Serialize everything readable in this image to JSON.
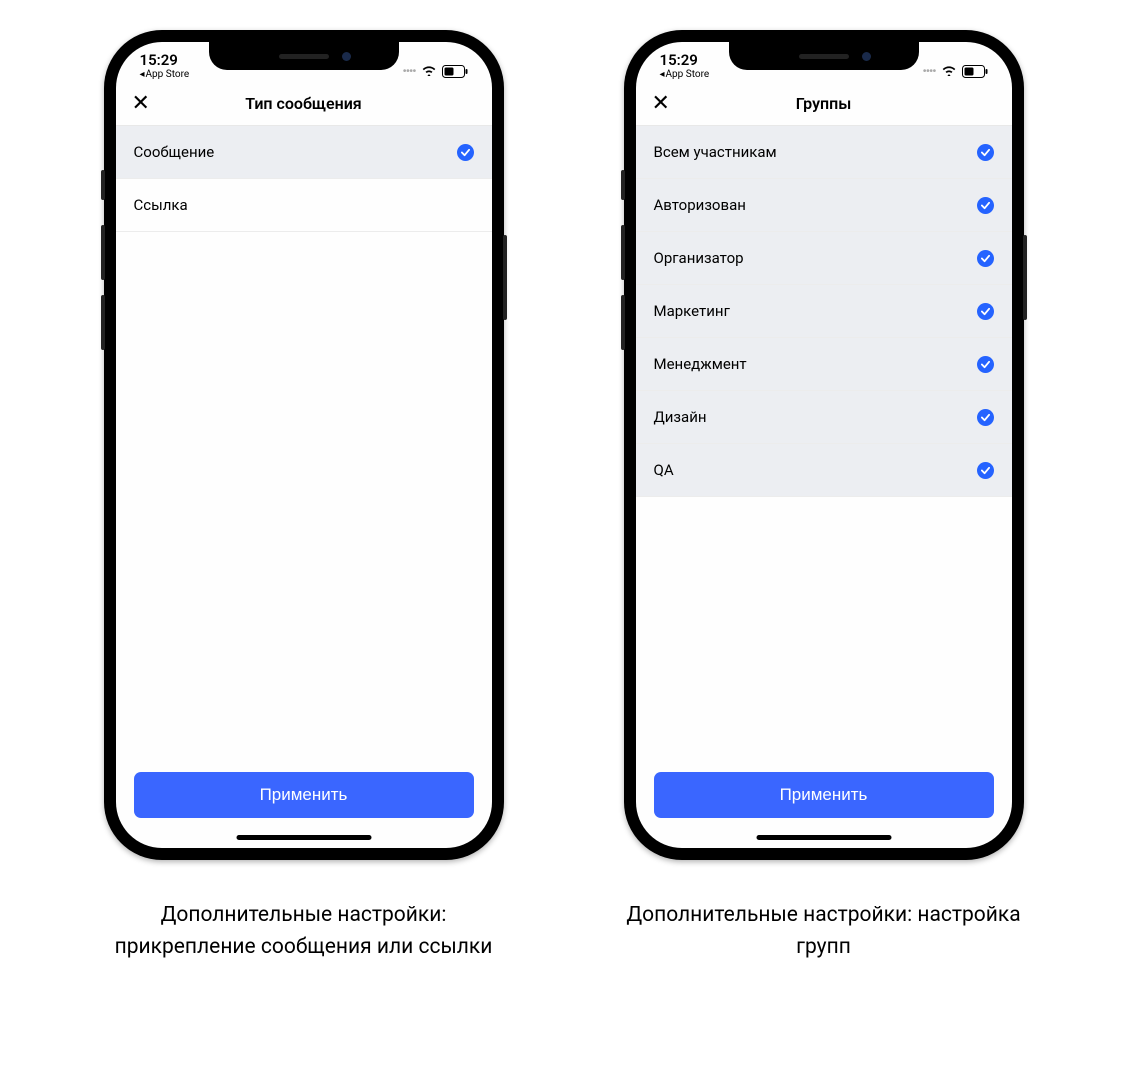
{
  "status": {
    "time": "15:29",
    "back_label": "App Store"
  },
  "phone1": {
    "title": "Тип сообщения",
    "rows": [
      {
        "label": "Сообщение",
        "checked": true,
        "selected": true
      },
      {
        "label": "Ссылка",
        "checked": false,
        "selected": false
      }
    ],
    "apply": "Применить",
    "caption": "Дополнительные настройки: прикрепление сообщения или ссылки"
  },
  "phone2": {
    "title": "Группы",
    "rows": [
      {
        "label": "Всем участникам",
        "checked": true,
        "selected": true
      },
      {
        "label": "Авторизован",
        "checked": true,
        "selected": true
      },
      {
        "label": "Организатор",
        "checked": true,
        "selected": true
      },
      {
        "label": "Маркетинг",
        "checked": true,
        "selected": true
      },
      {
        "label": "Менеджмент",
        "checked": true,
        "selected": true
      },
      {
        "label": "Дизайн",
        "checked": true,
        "selected": true
      },
      {
        "label": "QA",
        "checked": true,
        "selected": true
      }
    ],
    "apply": "Применить",
    "caption": "Дополнительные настройки: настройка групп"
  },
  "colors": {
    "accent": "#3a66ff",
    "selected_bg": "#eceef2"
  }
}
